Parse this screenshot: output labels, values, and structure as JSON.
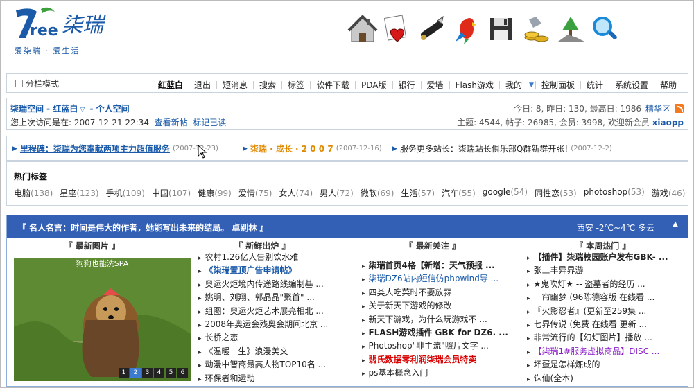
{
  "logo": {
    "brand": "柒瑞",
    "mark": "7ree",
    "slogan": "爱柒瑞 · 爱生活"
  },
  "toolbar_icons": [
    "home-icon",
    "favorite-page-icon",
    "pen-icon",
    "parrot-icon",
    "disk-icon",
    "gold-coins-icon",
    "tree-icon",
    "search-icon"
  ],
  "menubar": {
    "split_label": "分栏模式",
    "items": [
      "红蓝白",
      "退出",
      "短消息",
      "搜索",
      "标签",
      "软件下载",
      "PDA版",
      "银行",
      "爱墙",
      "Flash游戏",
      "我的",
      "控制面板",
      "统计",
      "系统设置",
      "帮助"
    ]
  },
  "info": {
    "title": "柒瑞空间 - 红蓝白",
    "title_suffix": " - 个人空间",
    "last_visit_label": "您上次访问是在: 2007-12-21 22:34",
    "link_new": "查看新帖",
    "link_read": "标记已读",
    "stats_day": "今日: 8, 昨日: 130, 最高日: 1986",
    "stats_link": "精华区",
    "stats_topics": "主题: 4544, 帖子: 26985, 会员: 3998, 欢迎新会员",
    "new_member": "xiaopp"
  },
  "news": [
    {
      "title": "里程碑：柒瑞为您奉献两项主力超值服务",
      "date": "(2007-12-23)"
    },
    {
      "title": "柒瑞 · 成长 · 2 0 0 7",
      "date": "(2007-12-16)"
    },
    {
      "title": "服务更多站长：柒瑞站长俱乐部Q群新群开张!",
      "date": "(2007-12-2)"
    }
  ],
  "tags": {
    "title": "热门标签",
    "items": [
      {
        "name": "电脑",
        "count": "(138)"
      },
      {
        "name": "星座",
        "count": "(123)"
      },
      {
        "name": "手机",
        "count": "(109)"
      },
      {
        "name": "中国",
        "count": "(107)"
      },
      {
        "name": "健康",
        "count": "(99)"
      },
      {
        "name": "爱情",
        "count": "(75)"
      },
      {
        "name": "女人",
        "count": "(74)"
      },
      {
        "name": "男人",
        "count": "(72)"
      },
      {
        "name": "微软",
        "count": "(69)"
      },
      {
        "name": "生活",
        "count": "(57)"
      },
      {
        "name": "汽车",
        "count": "(55)"
      },
      {
        "name": "google",
        "count": "(54)"
      },
      {
        "name": "同性恋",
        "count": "(53)"
      },
      {
        "name": "photoshop",
        "count": "(53)"
      },
      {
        "name": "游戏",
        "count": "(46)"
      }
    ]
  },
  "panel": {
    "quote": "『 名人名言：时间是伟大的作者，她能写出未来的结局。 卓别林 』",
    "weather": "西安 -2℃~4℃ 多云",
    "columns": [
      "『 最新图片 』",
      "『 新鲜出炉 』",
      "『 最新关注 』",
      "『 本周热门 』"
    ],
    "slide_caption": "狗狗也能洗SPA",
    "slide_nums": [
      "1",
      "2",
      "3",
      "4",
      "5",
      "6"
    ],
    "fresh": [
      "农村1.26亿人告别饮水难",
      "《柒瑞置顶广告申请帖》",
      "奥运火炬境内传递路线编制基 ...",
      "姚明、刘翔、郭晶晶\"聚首\" ...",
      "组图：奥运火炬艺术展亮相北 ...",
      "2008年奥运会残奥会期间北京 ...",
      "长桥之恋",
      "《温暖一生》浪漫美文",
      "动漫中智商最高人物TOP10名 ...",
      "环保者和运动"
    ],
    "focus": [
      "柒瑞首页4格【新增：天气预报 ...",
      "柒瑞DZ6站内短信仿phpwind导 ...",
      "四类人吃菜时不要放蒜",
      "关于新天下游戏的修改",
      "新天下游戏，为什么玩游戏不 ...",
      "FLASH游戏插件 GBK for DZ6. ...",
      "Photoshop\"非主流\"照片文字 ...",
      "翡氏数据零利润柒瑞会员特卖",
      "ps基本概念入门"
    ],
    "hot": [
      "【插件】柒瑞校园账户发布GBK- ...",
      "张三丰异界游",
      "★鬼吹灯★ -- 盗墓者的经历 ...",
      "一帘幽梦 (96陈德容版 在线看 ...",
      "『火影忍者』(更新至259集 ...",
      "七界传说 (免费 在线看 更新 ...",
      "非常流行的【幻灯图片】播放 ...",
      "【柒瑞1#服务虚拟商品】DISC ...",
      "坏蛋是怎样炼成的",
      "诛仙(全本)"
    ]
  }
}
